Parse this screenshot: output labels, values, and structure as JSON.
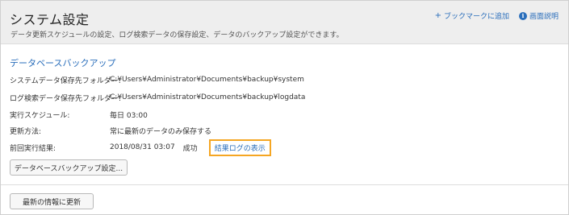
{
  "header": {
    "title": "システム設定",
    "subtitle": "データ更新スケジュールの設定、ログ検索データの保存設定、データのバックアップ設定ができます。",
    "bookmark_icon": "plus-icon",
    "bookmark_label": "ブックマークに追加",
    "help_icon": "info-icon",
    "help_label": "画面説明"
  },
  "backup": {
    "section_title": "データベースバックアップ",
    "rows": [
      {
        "label": "システムデータ保存先フォルダー:",
        "value": "C:¥Users¥Administrator¥Documents¥backup¥system"
      },
      {
        "label": "ログ検索データ保存先フォルダー:",
        "value": "C:¥Users¥Administrator¥Documents¥backup¥logdata"
      },
      {
        "label": "実行スケジュール:",
        "value": "毎日 03:00"
      },
      {
        "label": "更新方法:",
        "value": "常に最新のデータのみ保存する"
      },
      {
        "label": "前回実行結果:",
        "value": "2018/08/31 03:07",
        "status": "成功",
        "link": "結果ログの表示"
      }
    ],
    "settings_button": "データベースバックアップ設定..."
  },
  "footer": {
    "refresh_button": "最新の情報に更新"
  },
  "colors": {
    "link": "#2a6ebb",
    "highlight": "#f5a623",
    "header_bg": "#eeeeee"
  }
}
